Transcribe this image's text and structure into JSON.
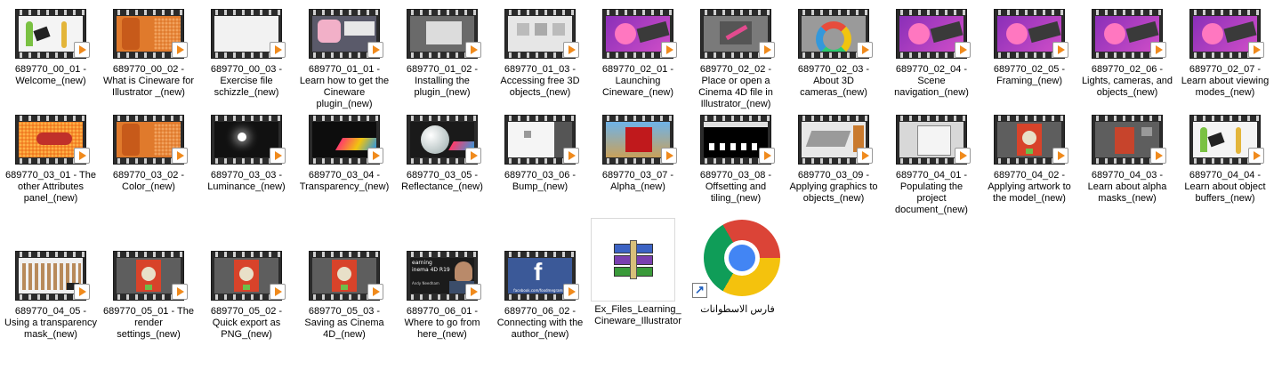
{
  "items": [
    {
      "label": "689770_00_01 - Welcome_(new)",
      "thumb": "welcome"
    },
    {
      "label": "689770_00_02 - What is Cineware for Illustrator _(new)",
      "thumb": "orange-can"
    },
    {
      "label": "689770_00_03 - Exercise file schizzle_(new)",
      "thumb": "white"
    },
    {
      "label": "689770_01_01 - Learn how to get the Cineware plugin_(new)",
      "thumb": "plugin-site"
    },
    {
      "label": "689770_01_02 - Installing the plugin_(new)",
      "thumb": "installer"
    },
    {
      "label": "689770_01_03 - Accessing free 3D objects_(new)",
      "thumb": "objects"
    },
    {
      "label": "689770_02_01 - Launching Cineware_(new)",
      "thumb": "purple-art"
    },
    {
      "label": "689770_02_02 - Place or open a Cinema 4D file in Illustrator_(new)",
      "thumb": "grey-pen"
    },
    {
      "label": "689770_02_03 - About 3D cameras_(new)",
      "thumb": "rainbow"
    },
    {
      "label": "689770_02_04 - Scene navigation_(new)",
      "thumb": "purple-art"
    },
    {
      "label": "689770_02_05 - Framing_(new)",
      "thumb": "purple-art"
    },
    {
      "label": "689770_02_06 - Lights, cameras, and objects_(new)",
      "thumb": "purple-art"
    },
    {
      "label": "689770_02_07 - Learn about viewing modes_(new)",
      "thumb": "purple-art"
    },
    {
      "label": "689770_03_01 - The other Attributes panel_(new)",
      "thumb": "orange-pop"
    },
    {
      "label": "689770_03_02 - Color_(new)",
      "thumb": "orange-can"
    },
    {
      "label": "689770_03_03 - Luminance_(new)",
      "thumb": "dark-light"
    },
    {
      "label": "689770_03_04 - Transparency_(new)",
      "thumb": "dark-prism"
    },
    {
      "label": "689770_03_05 - Reflectance_(new)",
      "thumb": "sphere"
    },
    {
      "label": "689770_03_06 - Bump_(new)",
      "thumb": "white-ui"
    },
    {
      "label": "689770_03_07 - Alpha_(new)",
      "thumb": "red-cube"
    },
    {
      "label": "689770_03_08 - Offsetting and tiling_(new)",
      "thumb": "bw-tiles"
    },
    {
      "label": "689770_03_09 - Applying graphics to objects_(new)",
      "thumb": "grey-slab"
    },
    {
      "label": "689770_04_01 - Populating the project document_(new)",
      "thumb": "dialog"
    },
    {
      "label": "689770_04_02 - Applying artwork to the model_(new)",
      "thumb": "red-poster"
    },
    {
      "label": "689770_04_03 - Learn about alpha masks_(new)",
      "thumb": "grey-poster"
    },
    {
      "label": "689770_04_04 - Learn about object buffers_(new)",
      "thumb": "welcome"
    },
    {
      "label": "689770_04_05 - Using a transparency mask_(new)",
      "thumb": "figures"
    },
    {
      "label": "689770_05_01 - The render settings_(new)",
      "thumb": "red-poster"
    },
    {
      "label": "689770_05_02 - Quick export as PNG_(new)",
      "thumb": "red-poster"
    },
    {
      "label": "689770_05_03 - Saving as Cinema 4D_(new)",
      "thumb": "red-poster"
    },
    {
      "label": "689770_06_01 - Where to go from here_(new)",
      "thumb": "presenter"
    },
    {
      "label": "689770_06_02 - Connecting with the author_(new)",
      "thumb": "facebook"
    }
  ],
  "thumb_texts": {
    "presenter_line1": "earning",
    "presenter_line2": "inema 4D R19",
    "presenter_name": "Andy Needham",
    "facebook_logo": "f",
    "facebook_url": "facebook.com/foodmegrammy"
  },
  "archive": {
    "label": "Ex_Files_Learning_Cineware_Illustrator",
    "icon": "winrar-archive-icon"
  },
  "shortcut": {
    "label": "فارس الاسطوانات",
    "icon": "chrome-icon"
  },
  "colors": {
    "play_badge": "#f08a1c",
    "film_frame": "#2b2b2b"
  }
}
